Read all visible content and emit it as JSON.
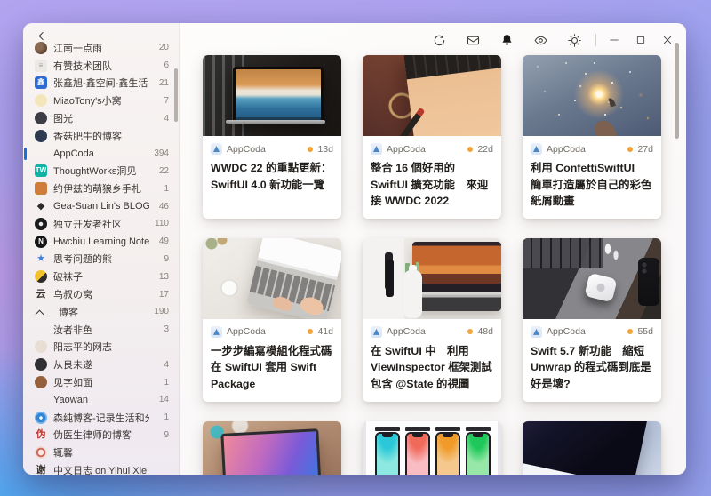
{
  "colors": {
    "accent": "#1a6ed8",
    "unread_dot": "#f0a43a",
    "background_top": "#b4a5f1",
    "background_bottom_left": "#40acf5",
    "background_bottom_right": "#97a4ef"
  },
  "toolbar": {
    "icons": [
      "sync-icon",
      "mark-all-read-icon",
      "notifications-icon",
      "hide-read-icon",
      "settings-icon"
    ],
    "window_controls": [
      "minimize",
      "maximize",
      "close"
    ]
  },
  "sidebar": {
    "back_icon": "back-arrow-icon",
    "items": [
      {
        "type": "feed",
        "label": "江南一点雨",
        "count": "20",
        "icon": {
          "shape": "circle",
          "bg": "radial-gradient(circle at 35% 35%, #8a6a52 0 30%, #5d4536 70%)"
        }
      },
      {
        "type": "feed",
        "label": "有赞技术团队",
        "count": "6",
        "icon": {
          "shape": "square",
          "bg": "#ebe9e6",
          "fg": "#a09a92",
          "char": "≡"
        }
      },
      {
        "type": "feed",
        "label": "张鑫旭-鑫空间-鑫生活",
        "count": "21",
        "icon": {
          "shape": "square",
          "bg": "#2e6cd4",
          "fg": "#ffffff",
          "char": "鑫"
        }
      },
      {
        "type": "feed",
        "label": "MiaoTony's小窝",
        "count": "7",
        "icon": {
          "shape": "circle",
          "bg": "#f4e6ba"
        }
      },
      {
        "type": "feed",
        "label": "图光",
        "count": "4",
        "icon": {
          "shape": "circle",
          "bg": "#3d3d47"
        }
      },
      {
        "type": "feed",
        "label": "香菇肥牛的博客",
        "count": "",
        "icon": {
          "shape": "circle",
          "bg": "#2d3950"
        }
      },
      {
        "type": "feed",
        "label": "AppCoda",
        "count": "394",
        "selected": true,
        "icon": {
          "shape": "none"
        }
      },
      {
        "type": "feed",
        "label": "ThoughtWorks洞见",
        "count": "22",
        "icon": {
          "shape": "square",
          "bg": "#12b2a4",
          "fg": "#ffffff",
          "char": "TW"
        }
      },
      {
        "type": "feed",
        "label": "约伊兹的萌狼乡手札",
        "count": "1",
        "icon": {
          "shape": "square",
          "bg": "#cf7d3a"
        }
      },
      {
        "type": "feed",
        "label": "Gea-Suan Lin's BLOG",
        "count": "46",
        "icon": {
          "shape": "char",
          "fg": "#2b2b2b",
          "char": "◆"
        }
      },
      {
        "type": "feed",
        "label": "独立开发者社区",
        "count": "110",
        "icon": {
          "shape": "circle",
          "bg": "radial-gradient(circle at 50% 50%, #ececec 0 2px, #1b1b1d 2.5px)"
        }
      },
      {
        "type": "feed",
        "label": "Hwchiu Learning Note",
        "count": "49",
        "icon": {
          "shape": "circle",
          "bg": "#141414",
          "fg": "#ffffff",
          "char": "N"
        }
      },
      {
        "type": "feed",
        "label": "思考问题的熊",
        "count": "9",
        "icon": {
          "shape": "char",
          "fg": "#3f7ed8",
          "char": "★"
        }
      },
      {
        "type": "feed",
        "label": "破袜子",
        "count": "13",
        "icon": {
          "shape": "circle",
          "bg": "linear-gradient(135deg, #f2c22e 0 55%, #2e2c28 55%)"
        }
      },
      {
        "type": "feed",
        "label": "乌叔の窝",
        "count": "17",
        "icon": {
          "shape": "char",
          "fg": "#3a3530",
          "char": "云"
        }
      },
      {
        "type": "group",
        "label": "博客",
        "count": "190"
      },
      {
        "type": "feed",
        "label": "汝者非鱼",
        "count": "3",
        "icon": {
          "shape": "none"
        }
      },
      {
        "type": "feed",
        "label": "阳志平的网志",
        "count": "",
        "icon": {
          "shape": "circle",
          "bg": "#e9ded4"
        }
      },
      {
        "type": "feed",
        "label": "从良未遂",
        "count": "4",
        "icon": {
          "shape": "circle",
          "bg": "#2f2f34"
        }
      },
      {
        "type": "feed",
        "label": "见字如面",
        "count": "1",
        "icon": {
          "shape": "circle",
          "bg": "#95613c"
        }
      },
      {
        "type": "feed",
        "label": "Yaowan",
        "count": "14",
        "icon": {
          "shape": "none"
        }
      },
      {
        "type": "feed",
        "label": "森纯博客-记录生活和分享知识的…",
        "count": "1",
        "icon": {
          "shape": "circle",
          "bg": "radial-gradient(circle at 50% 50%, #ffffff 0 1.5px, #2f86d8 2px 5px, #77b3e8 5.5px)"
        }
      },
      {
        "type": "feed",
        "label": "伪医生律师的博客",
        "count": "9",
        "icon": {
          "shape": "char",
          "fg": "#c23a2e",
          "char": "伪"
        }
      },
      {
        "type": "feed",
        "label": "辄馨",
        "count": "",
        "icon": {
          "shape": "circle",
          "bg": "radial-gradient(circle, #f7e8e4 0 3px, #cf6a5c 3.5px 5px, #f3dcd6 5.5px)"
        }
      },
      {
        "type": "feed",
        "label": "中文日志 on Yihui Xie | 谢益辉",
        "count": "",
        "icon": {
          "shape": "char",
          "fg": "#3a3530",
          "char": "谢"
        }
      }
    ]
  },
  "feed": {
    "cards": [
      {
        "source": "AppCoda",
        "age": "13d",
        "unread": true,
        "title": "WWDC 22 的重點更新：SwiftUI 4.0 新功能一覽",
        "image": "macbook-window-beach"
      },
      {
        "source": "AppCoda",
        "age": "22d",
        "unread": true,
        "title": "整合 16 個好用的 SwiftUI 擴充功能　來迎接 WWDC 2022",
        "image": "glasses-keyboard-desk"
      },
      {
        "source": "AppCoda",
        "age": "27d",
        "unread": true,
        "title": "利用 ConfettiSwiftUI　簡單打造屬於自己的彩色紙屑動畫",
        "image": "sparkler"
      },
      {
        "source": "AppCoda",
        "age": "41d",
        "unread": true,
        "title": "一步步編寫模組化程式碼　在 SwiftUI 套用 Swift Package",
        "image": "hands-laptop-desk"
      },
      {
        "source": "AppCoda",
        "age": "48d",
        "unread": true,
        "title": "在 SwiftUI 中　利用 ViewInspector 框架測試包含 @State 的視圖",
        "image": "osmo-camera-desk"
      },
      {
        "source": "AppCoda",
        "age": "55d",
        "unread": true,
        "title": "Swift 5.7 新功能　縮短 Unwrap 的程式碼到底是好是壞?",
        "image": "airtag-macbook"
      },
      {
        "source": "",
        "age": "",
        "unread": false,
        "title": "",
        "image": "laptop-gradient-screen"
      },
      {
        "source": "",
        "age": "",
        "unread": false,
        "title": "",
        "image": "iphone-color-mockups"
      },
      {
        "source": "",
        "age": "",
        "unread": false,
        "title": "",
        "image": "dark-laptop-blue"
      }
    ]
  }
}
